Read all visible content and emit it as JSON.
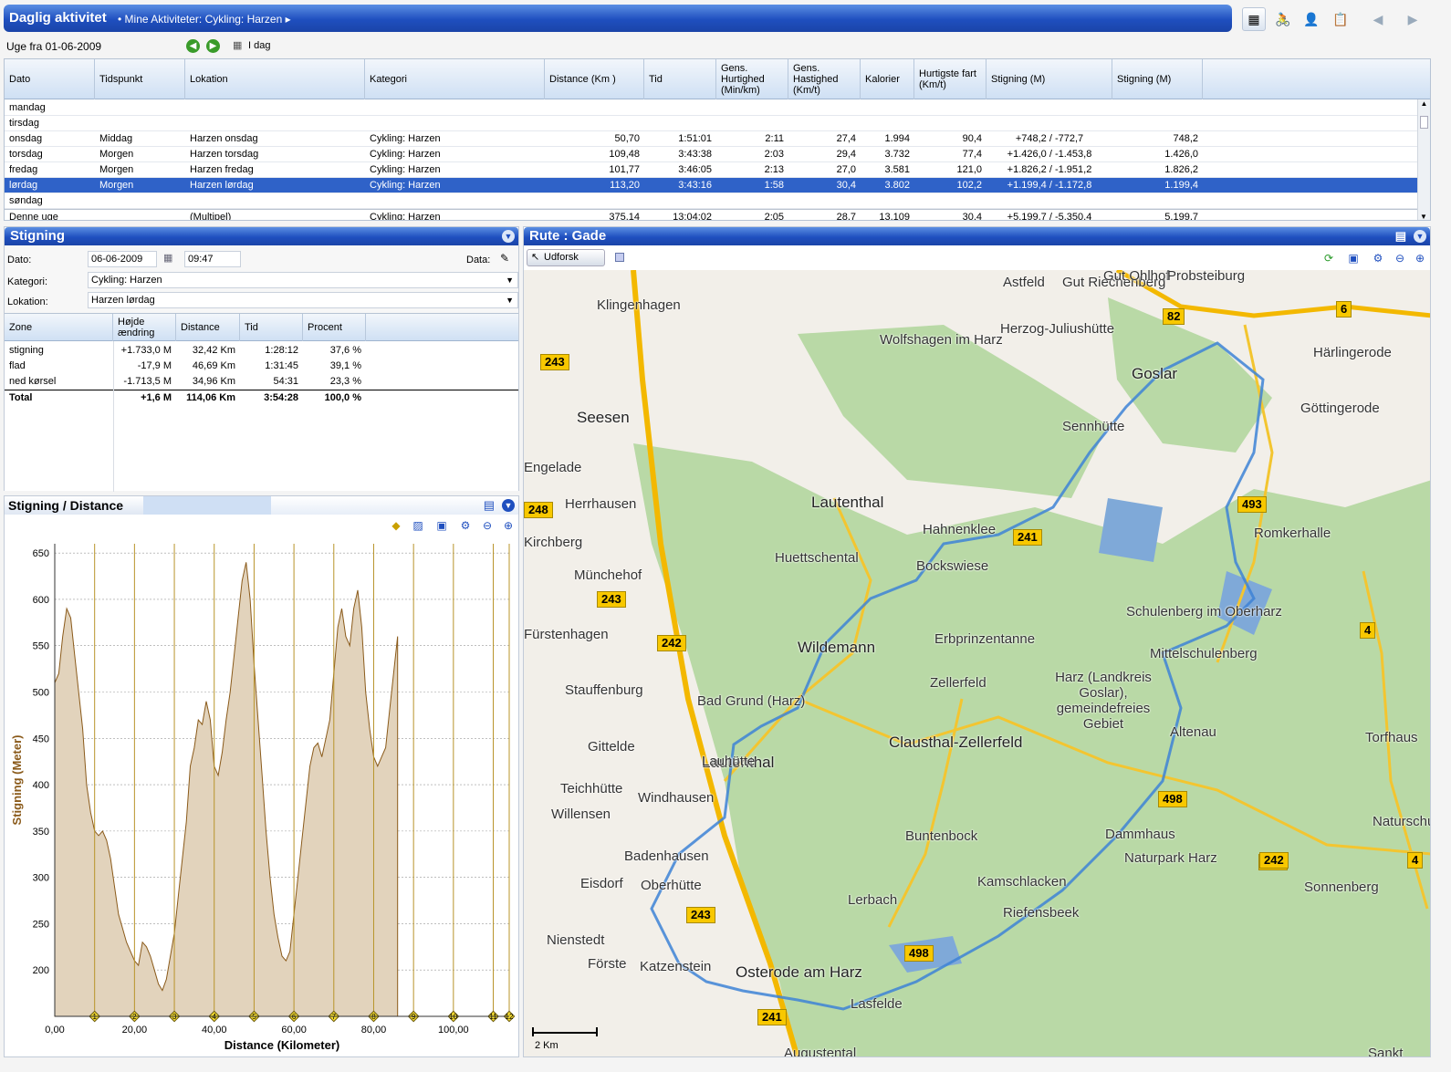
{
  "header": {
    "title": "Daglig aktivitet",
    "breadcrumb": "Mine Aktiviteter: Cykling: Harzen"
  },
  "week": {
    "label": "Uge fra 01-06-2009",
    "today_label": "I dag"
  },
  "table": {
    "columns": [
      "Dato",
      "Tidspunkt",
      "Lokation",
      "Kategori",
      "Distance (Km )",
      "Tid",
      "Gens. Hurtighed (Min/km)",
      "Gens. Hastighed (Km/t)",
      "Kalorier",
      "Hurtigste fart (Km/t)",
      "Stigning (M)",
      "Stigning (M)"
    ],
    "rows": [
      {
        "dato": "mandag",
        "tid_punkt": "",
        "lok": "",
        "kat": "",
        "dist": "",
        "tid": "",
        "hurt": "",
        "hast": "",
        "kal": "",
        "fart": "",
        "stig1": "",
        "stig2": ""
      },
      {
        "dato": "tirsdag",
        "tid_punkt": "",
        "lok": "",
        "kat": "",
        "dist": "",
        "tid": "",
        "hurt": "",
        "hast": "",
        "kal": "",
        "fart": "",
        "stig1": "",
        "stig2": ""
      },
      {
        "dato": "onsdag",
        "tid_punkt": "Middag",
        "lok": "Harzen onsdag",
        "kat": "Cykling: Harzen",
        "dist": "50,70",
        "tid": "1:51:01",
        "hurt": "2:11",
        "hast": "27,4",
        "kal": "1.994",
        "fart": "90,4",
        "stig1": "+748,2 / -772,7",
        "stig2": "748,2"
      },
      {
        "dato": "torsdag",
        "tid_punkt": "Morgen",
        "lok": "Harzen torsdag",
        "kat": "Cykling: Harzen",
        "dist": "109,48",
        "tid": "3:43:38",
        "hurt": "2:03",
        "hast": "29,4",
        "kal": "3.732",
        "fart": "77,4",
        "stig1": "+1.426,0 / -1.453,8",
        "stig2": "1.426,0"
      },
      {
        "dato": "fredag",
        "tid_punkt": "Morgen",
        "lok": "Harzen fredag",
        "kat": "Cykling: Harzen",
        "dist": "101,77",
        "tid": "3:46:05",
        "hurt": "2:13",
        "hast": "27,0",
        "kal": "3.581",
        "fart": "121,0",
        "stig1": "+1.826,2 / -1.951,2",
        "stig2": "1.826,2"
      },
      {
        "dato": "lørdag",
        "tid_punkt": "Morgen",
        "lok": "Harzen lørdag",
        "kat": "Cykling: Harzen",
        "dist": "113,20",
        "tid": "3:43:16",
        "hurt": "1:58",
        "hast": "30,4",
        "kal": "3.802",
        "fart": "102,2",
        "stig1": "+1.199,4 / -1.172,8",
        "stig2": "1.199,4"
      },
      {
        "dato": "søndag",
        "tid_punkt": "",
        "lok": "",
        "kat": "",
        "dist": "",
        "tid": "",
        "hurt": "",
        "hast": "",
        "kal": "",
        "fart": "",
        "stig1": "",
        "stig2": ""
      },
      {
        "dato": "Denne uge",
        "tid_punkt": "",
        "lok": "(Multipel)",
        "kat": "Cykling: Harzen",
        "dist": "375,14",
        "tid": "13:04:02",
        "hurt": "2:05",
        "hast": "28,7",
        "kal": "13.109",
        "fart": "30,4",
        "stig1": "+5.199,7 / -5.350,4",
        "stig2": "5.199,7"
      }
    ]
  },
  "stigning_panel": {
    "title": "Stigning",
    "dato_label": "Dato:",
    "dato": "06-06-2009",
    "time": "09:47",
    "data_label": "Data:",
    "kategori_label": "Kategori:",
    "kategori": "Cykling: Harzen",
    "lokation_label": "Lokation:",
    "lokation": "Harzen lørdag",
    "zone_cols": [
      "Zone",
      "Højde ændring",
      "Distance",
      "Tid",
      "Procent"
    ],
    "zones": [
      {
        "zone": "stigning",
        "hojde": "+1.733,0 M",
        "dist": "32,42 Km",
        "tid": "1:28:12",
        "pct": "37,6 %"
      },
      {
        "zone": "flad",
        "hojde": "-17,9 M",
        "dist": "46,69 Km",
        "tid": "1:31:45",
        "pct": "39,1 %"
      },
      {
        "zone": "ned kørsel",
        "hojde": "-1.713,5 M",
        "dist": "34,96 Km",
        "tid": "54:31",
        "pct": "23,3 %"
      },
      {
        "zone": "Total",
        "hojde": "+1,6 M",
        "dist": "114,06 Km",
        "tid": "3:54:28",
        "pct": "100,0 %"
      }
    ]
  },
  "chart_panel": {
    "title": "Stigning / Distance"
  },
  "chart_data": {
    "type": "area",
    "xlabel": "Distance (Kilometer)",
    "ylabel": "Stigning (Meter)",
    "xlim": [
      0,
      114
    ],
    "ylim": [
      150,
      660
    ],
    "x_ticks": [
      "0,00",
      "20,00",
      "40,00",
      "60,00",
      "80,00",
      "100,00"
    ],
    "y_ticks": [
      "200",
      "250",
      "300",
      "350",
      "400",
      "450",
      "500",
      "550",
      "600",
      "650"
    ],
    "markers": [
      1,
      2,
      3,
      4,
      5,
      6,
      7,
      8,
      9,
      10,
      11,
      12
    ],
    "marker_x": [
      10,
      20,
      30,
      40,
      50,
      60,
      70,
      80,
      90,
      100,
      110,
      114
    ],
    "x": [
      0,
      1,
      2,
      3,
      4,
      5,
      6,
      7,
      8,
      9,
      10,
      11,
      12,
      13,
      14,
      15,
      16,
      17,
      18,
      19,
      20,
      21,
      22,
      23,
      24,
      25,
      26,
      27,
      28,
      29,
      30,
      31,
      32,
      33,
      34,
      35,
      36,
      37,
      38,
      39,
      40,
      41,
      42,
      43,
      44,
      45,
      46,
      47,
      48,
      49,
      50,
      51,
      52,
      53,
      54,
      55,
      56,
      57,
      58,
      59,
      60,
      61,
      62,
      63,
      64,
      65,
      66,
      67,
      68,
      69,
      70,
      71,
      72,
      73,
      74,
      75,
      76,
      77,
      78,
      79,
      80,
      81,
      82,
      83,
      84,
      85,
      86,
      87,
      88,
      89,
      90,
      91,
      92,
      93,
      94,
      95,
      96,
      97,
      98,
      99,
      100,
      101,
      102,
      103,
      104,
      105,
      106,
      107,
      108,
      109,
      110,
      111,
      112,
      113,
      114
    ],
    "y": [
      510,
      520,
      560,
      590,
      580,
      540,
      500,
      460,
      400,
      370,
      350,
      345,
      350,
      340,
      320,
      290,
      260,
      245,
      230,
      220,
      210,
      205,
      230,
      225,
      215,
      200,
      185,
      178,
      190,
      215,
      240,
      280,
      320,
      360,
      420,
      440,
      470,
      465,
      490,
      470,
      420,
      410,
      435,
      470,
      500,
      540,
      580,
      620,
      640,
      600,
      530,
      470,
      410,
      350,
      300,
      260,
      235,
      215,
      210,
      220,
      260,
      300,
      340,
      380,
      420,
      440,
      445,
      430,
      450,
      470,
      520,
      570,
      590,
      560,
      550,
      590,
      610,
      570,
      500,
      460,
      430,
      420,
      430,
      440,
      480,
      520,
      560
    ]
  },
  "map_panel": {
    "title": "Rute : Gade",
    "udforsk": "Udforsk",
    "scale": "2 Km",
    "labels": [
      {
        "t": "Astfeld"
      },
      {
        "t": "Gut Riechenberg"
      },
      {
        "t": "Gut Ohlhof"
      },
      {
        "t": "Probsteiburg"
      },
      {
        "t": "Klingenhagen"
      },
      {
        "t": "Wolfshagen im Harz"
      },
      {
        "t": "Herzog-Juliushütte"
      },
      {
        "t": "Goslar"
      },
      {
        "t": "Härlingerode"
      },
      {
        "t": "Seesen"
      },
      {
        "t": "Göttingerode"
      },
      {
        "t": "Sennhütte"
      },
      {
        "t": "Engelade"
      },
      {
        "t": "Herrhausen"
      },
      {
        "t": "Lautenthal"
      },
      {
        "t": "Hahnenklee"
      },
      {
        "t": "Romkerhalle"
      },
      {
        "t": "Kirchberg"
      },
      {
        "t": "Huettschental"
      },
      {
        "t": "Bockswiese"
      },
      {
        "t": "Münchehof"
      },
      {
        "t": "Schulenberg im Oberharz"
      },
      {
        "t": "Fürstenhagen"
      },
      {
        "t": "Erbprinzentanne"
      },
      {
        "t": "Wildemann"
      },
      {
        "t": "Mittelschulenberg"
      },
      {
        "t": "Stauffenburg"
      },
      {
        "t": "Zellerfeld"
      },
      {
        "t": "Harz (Landkreis Goslar), gemeindefreies Gebiet"
      },
      {
        "t": "Bad Grund (Harz)"
      },
      {
        "t": "Clausthal-Zellerfeld"
      },
      {
        "t": "Altenau"
      },
      {
        "t": "Torfhaus"
      },
      {
        "t": "Gittelde"
      },
      {
        "t": "Lautenthal"
      },
      {
        "t": "Lauhütte"
      },
      {
        "t": "Teichhütte"
      },
      {
        "t": "Windhausen"
      },
      {
        "t": "Willensen"
      },
      {
        "t": "Naturschutz Oberha"
      },
      {
        "t": "Buntenbock"
      },
      {
        "t": "Dammhaus"
      },
      {
        "t": "Badenhausen"
      },
      {
        "t": "Naturpark Harz"
      },
      {
        "t": "Eisdorf"
      },
      {
        "t": "Oberhütte"
      },
      {
        "t": "Kamschlacken"
      },
      {
        "t": "Sonnenberg"
      },
      {
        "t": "Lerbach"
      },
      {
        "t": "Riefensbeek"
      },
      {
        "t": "Nienstedt"
      },
      {
        "t": "Förste"
      },
      {
        "t": "Katzenstein"
      },
      {
        "t": "Osterode am Harz"
      },
      {
        "t": "Lasfelde"
      },
      {
        "t": "Augustental"
      },
      {
        "t": "Sankt"
      }
    ],
    "shields": [
      "82",
      "6",
      "243",
      "248",
      "243",
      "242",
      "241",
      "493",
      "4",
      "242",
      "498",
      "242",
      "4",
      "243",
      "498",
      "241"
    ]
  }
}
